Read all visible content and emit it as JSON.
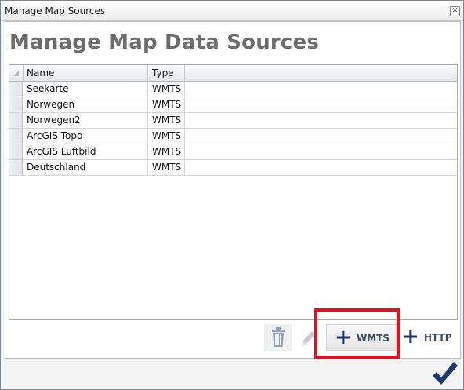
{
  "window": {
    "title": "Manage Map Sources"
  },
  "page": {
    "title": "Manage Map Data Sources"
  },
  "grid": {
    "columns": [
      "Name",
      "Type"
    ],
    "rows": [
      {
        "name": "Seekarte",
        "type": "WMTS"
      },
      {
        "name": "Norwegen",
        "type": "WMTS"
      },
      {
        "name": "Norwegen2",
        "type": "WMTS"
      },
      {
        "name": "ArcGIS Topo",
        "type": "WMTS"
      },
      {
        "name": "ArcGIS Luftbild",
        "type": "WMTS"
      },
      {
        "name": "Deutschland",
        "type": "WMTS"
      }
    ]
  },
  "toolbar": {
    "delete_icon": "trash-icon",
    "edit_icon": "pencil-icon",
    "add_wmts_label": "WMTS",
    "add_http_label": "HTTP"
  },
  "footer": {
    "ok_icon": "checkmark-icon"
  },
  "colors": {
    "accent": "#1c3a6e",
    "highlight": "#e0121b",
    "title_text": "#6d6d6d"
  }
}
